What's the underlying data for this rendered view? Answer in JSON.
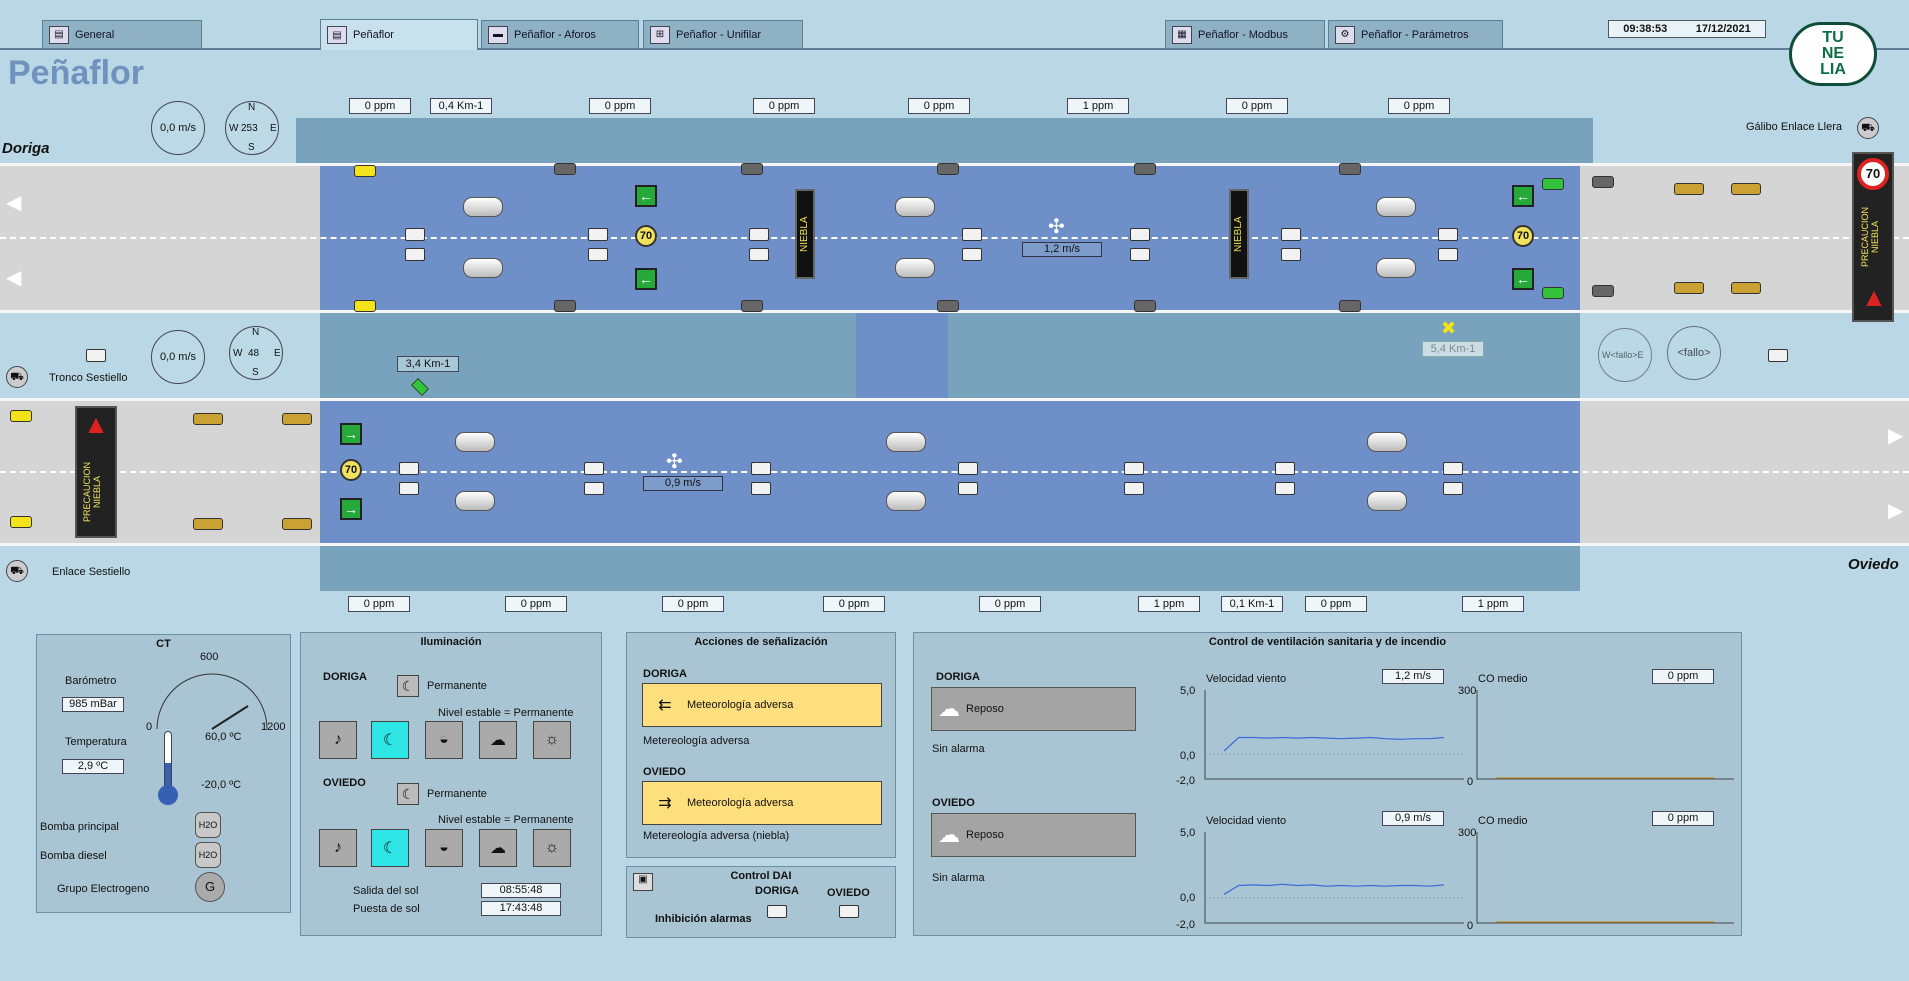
{
  "tabs": [
    {
      "label": "General",
      "icon": "document-icon"
    },
    {
      "label": "Peñaflor",
      "icon": "document-icon"
    },
    {
      "label": "Peñaflor - Aforos",
      "icon": "car-icon"
    },
    {
      "label": "Peñaflor - Unifilar",
      "icon": "schematic-icon"
    },
    {
      "label": "Peñaflor - Modbus",
      "icon": "network-icon"
    },
    {
      "label": "Peñaflor - Parámetros",
      "icon": "gear-icon"
    }
  ],
  "clock": {
    "time": "09:38:53",
    "date": "17/12/2021"
  },
  "logo": {
    "line1": "TU",
    "line2": "NE",
    "line3": "LIA"
  },
  "page_title": "Peñaflor",
  "roads": {
    "doriga": "Doriga",
    "oviedo": "Oviedo"
  },
  "labels": {
    "galibo": "Gálibo Enlace Llera",
    "tronco": "Tronco Sestiello",
    "enlace": "Enlace Sestiello"
  },
  "top_sensors": [
    "0 ppm",
    "0,4 Km-1",
    "0 ppm",
    "0 ppm",
    "0 ppm",
    "1 ppm",
    "0 ppm",
    "0 ppm"
  ],
  "bottom_sensors": [
    "0 ppm",
    "0 ppm",
    "0 ppm",
    "0 ppm",
    "0 ppm",
    "1 ppm",
    "0,1 Km-1",
    "0 ppm",
    "1 ppm"
  ],
  "mid_sensors": {
    "left": "3,4 Km-1",
    "right": "5,4 Km-1"
  },
  "wind_gauges": {
    "top": {
      "speed": "0,0 m/s",
      "direction": "253"
    },
    "mid": {
      "speed": "0,0 m/s",
      "direction": "48"
    },
    "right_fault": "<fallo>",
    "compass_fault": "W<fallo>E"
  },
  "compass_letters": {
    "n": "N",
    "s": "S",
    "e": "E",
    "w": "W"
  },
  "fans": {
    "doriga": "1,2 m/s",
    "oviedo": "0,9 m/s"
  },
  "speed_limit": "70",
  "niebla": "NIEBLA",
  "precaucion": "PRECAUCION NIEBLA",
  "ct": {
    "title": "CT",
    "barometro_label": "Barómetro",
    "barometro_value": "985 mBar",
    "dial_min": "0",
    "dial_mid": "600",
    "dial_max": "1200",
    "temperatura_label": "Temperatura",
    "temperatura_value": "2,9 ºC",
    "temp_high": "60,0 ºC",
    "temp_low": "-20,0 ºC",
    "bomba_principal": "Bomba principal",
    "bomba_diesel": "Bomba diesel",
    "grupo": "Grupo Electrogeno",
    "h2o": "H2O"
  },
  "iluminacion": {
    "title": "Iluminación",
    "doriga": "DORIGA",
    "oviedo": "OVIEDO",
    "mode": "Permanente",
    "nivel": "Nivel estable = Permanente",
    "salida_label": "Salida del sol",
    "salida_value": "08:55:48",
    "puesta_label": "Puesta de sol",
    "puesta_value": "17:43:48"
  },
  "senalizacion": {
    "title": "Acciones de señalización",
    "doriga": "DORIGA",
    "doriga_action": "Meteorología adversa",
    "doriga_note": "Metereología adversa",
    "oviedo": "OVIEDO",
    "oviedo_action": "Meteorología adversa",
    "oviedo_note": "Metereología adversa (niebla)"
  },
  "dai": {
    "title": "Control DAI",
    "doriga": "DORIGA",
    "oviedo": "OVIEDO",
    "inhibicion": "Inhibición alarmas"
  },
  "ventilacion": {
    "title": "Control de ventilación sanitaria y de incendio",
    "doriga": "DORIGA",
    "oviedo": "OVIEDO",
    "state": "Reposo",
    "alarm": "Sin alarma",
    "velocidad_label": "Velocidad viento",
    "co_label": "CO medio",
    "doriga_vel": "1,2 m/s",
    "oviedo_vel": "0,9 m/s",
    "doriga_co": "0 ppm",
    "oviedo_co": "0 ppm",
    "vel_axis": [
      "5,0",
      "0,0",
      "-2,0"
    ],
    "co_axis": [
      "300",
      "0"
    ]
  },
  "chart_data": [
    {
      "type": "line",
      "title": "",
      "ylabel": "Velocidad viento",
      "ylim": [
        -2,
        5
      ],
      "series": [
        {
          "values": [
            0.2,
            1.3,
            1.3,
            1.25,
            1.3,
            1.25,
            1.3,
            1.25,
            1.2,
            1.25,
            1.3,
            1.2,
            1.15,
            1.2,
            1.2,
            1.3
          ]
        }
      ]
    },
    {
      "type": "line",
      "title": "",
      "ylabel": "CO medio",
      "ylim": [
        0,
        300
      ],
      "series": [
        {
          "values": [
            0,
            0,
            0,
            0,
            0,
            0,
            0,
            0
          ]
        }
      ]
    },
    {
      "type": "line",
      "title": "",
      "ylabel": "Velocidad viento",
      "ylim": [
        -2,
        5
      ],
      "series": [
        {
          "values": [
            0.2,
            0.9,
            0.95,
            0.9,
            1.0,
            0.9,
            0.95,
            0.85,
            0.9,
            0.85,
            0.9,
            0.85,
            0.9,
            0.9,
            0.85,
            0.95
          ]
        }
      ]
    },
    {
      "type": "line",
      "title": "",
      "ylabel": "CO medio",
      "ylim": [
        0,
        300
      ],
      "series": [
        {
          "values": [
            0,
            0,
            0,
            0,
            0,
            0,
            0,
            0
          ]
        }
      ]
    }
  ]
}
